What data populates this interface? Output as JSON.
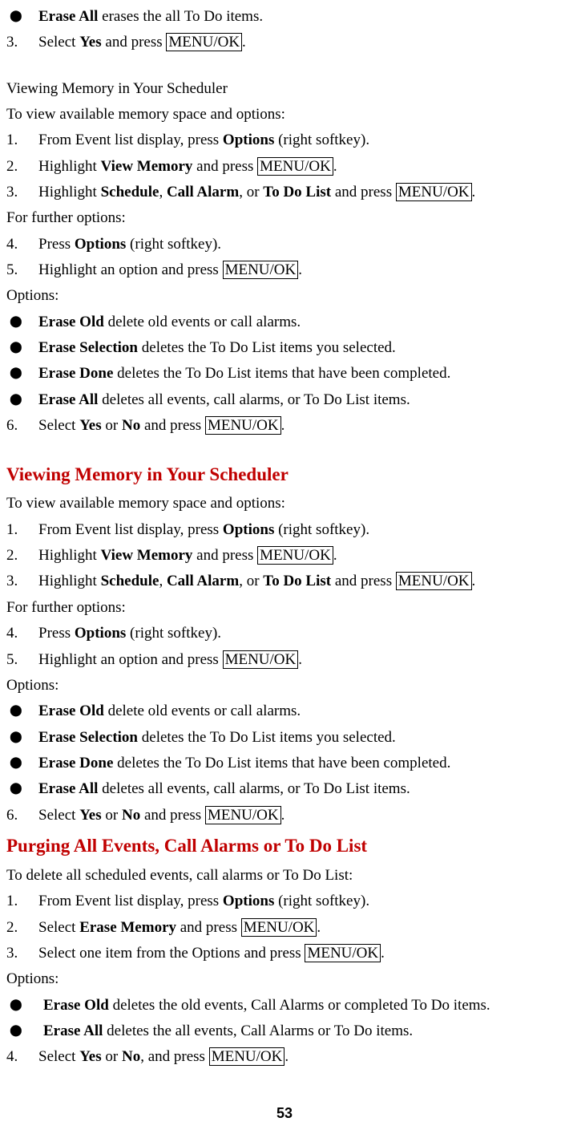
{
  "top_bullet": {
    "b": "Erase All",
    "rest": " erases the all To Do items."
  },
  "top_step3": {
    "n": "3.",
    "pre": "Select ",
    "b1": "Yes",
    "mid": " and press ",
    "key": "MENU/OK",
    "post": "."
  },
  "sec1_title": "Viewing Memory in Your Scheduler",
  "sec1_intro": "To view available memory space and options:",
  "sec1_steps": [
    {
      "n": "1.",
      "parts": [
        {
          "t": "From Event list display, press "
        },
        {
          "t": "Options",
          "b": 1
        },
        {
          "t": " (right softkey)."
        }
      ]
    },
    {
      "n": "2.",
      "parts": [
        {
          "t": "Highlight "
        },
        {
          "t": "View Memory",
          "b": 1
        },
        {
          "t": " and press "
        },
        {
          "t": "MENU/OK",
          "k": 1
        },
        {
          "t": "."
        }
      ]
    },
    {
      "n": "3.",
      "parts": [
        {
          "t": "Highlight "
        },
        {
          "t": "Schedule",
          "b": 1
        },
        {
          "t": ", "
        },
        {
          "t": "Call Alarm",
          "b": 1
        },
        {
          "t": ", or "
        },
        {
          "t": "To Do List",
          "b": 1
        },
        {
          "t": " and press "
        },
        {
          "t": "MENU/OK",
          "k": 1
        },
        {
          "t": "."
        }
      ]
    }
  ],
  "sec1_further": "For further options:",
  "sec1_steps_b": [
    {
      "n": "4.",
      "parts": [
        {
          "t": "Press "
        },
        {
          "t": "Options",
          "b": 1
        },
        {
          "t": " (right softkey)."
        }
      ]
    },
    {
      "n": "5.",
      "parts": [
        {
          "t": "Highlight an option and press "
        },
        {
          "t": "MENU/OK",
          "k": 1
        },
        {
          "t": "."
        }
      ]
    }
  ],
  "options_label": "Options:",
  "sec1_bullets": [
    {
      "b": "Erase Old",
      "rest": " delete old events or call alarms."
    },
    {
      "b": "Erase Selection",
      "rest": " deletes the To Do List items you selected."
    },
    {
      "b": "Erase Done",
      "rest": " deletes the To Do List items that have been completed."
    },
    {
      "b": "Erase All",
      "rest": " deletes all events, call alarms, or To Do List items."
    }
  ],
  "sec1_step6": {
    "n": "6.",
    "parts": [
      {
        "t": "Select "
      },
      {
        "t": "Yes",
        "b": 1
      },
      {
        "t": " or "
      },
      {
        "t": "No",
        "b": 1
      },
      {
        "t": " and press "
      },
      {
        "t": "MENU/OK",
        "k": 1
      },
      {
        "t": "."
      }
    ]
  },
  "sec2_title": "Viewing Memory in Your Scheduler",
  "sec2_intro": "To view available memory space and options:",
  "sec2_steps": [
    {
      "n": "1.",
      "parts": [
        {
          "t": "From Event list display, press "
        },
        {
          "t": "Options",
          "b": 1
        },
        {
          "t": " (right softkey)."
        }
      ]
    },
    {
      "n": "2.",
      "parts": [
        {
          "t": "Highlight "
        },
        {
          "t": "View Memory",
          "b": 1
        },
        {
          "t": " and press "
        },
        {
          "t": "MENU/OK",
          "k": 1
        },
        {
          "t": "."
        }
      ]
    },
    {
      "n": "3.",
      "parts": [
        {
          "t": "Highlight "
        },
        {
          "t": "Schedule",
          "b": 1
        },
        {
          "t": ", "
        },
        {
          "t": "Call Alarm",
          "b": 1
        },
        {
          "t": ", or "
        },
        {
          "t": "To Do List",
          "b": 1
        },
        {
          "t": " and press "
        },
        {
          "t": "MENU/OK",
          "k": 1
        },
        {
          "t": "."
        }
      ]
    }
  ],
  "sec2_further": "For further options:",
  "sec2_steps_b": [
    {
      "n": "4.",
      "parts": [
        {
          "t": "Press "
        },
        {
          "t": "Options",
          "b": 1
        },
        {
          "t": " (right softkey)."
        }
      ]
    },
    {
      "n": "5.",
      "parts": [
        {
          "t": "Highlight an option and press "
        },
        {
          "t": "MENU/OK",
          "k": 1
        },
        {
          "t": "."
        }
      ]
    }
  ],
  "sec2_bullets": [
    {
      "b": "Erase Old",
      "rest": " delete old events or call alarms."
    },
    {
      "b": "Erase Selection",
      "rest": " deletes the To Do List items you selected."
    },
    {
      "b": "Erase Done",
      "rest": " deletes the To Do List items that have been completed."
    },
    {
      "b": "Erase All",
      "rest": " deletes all events, call alarms, or To Do List items."
    }
  ],
  "sec2_step6": {
    "n": "6.",
    "parts": [
      {
        "t": "Select "
      },
      {
        "t": "Yes",
        "b": 1
      },
      {
        "t": " or "
      },
      {
        "t": "No",
        "b": 1
      },
      {
        "t": " and press "
      },
      {
        "t": "MENU/OK",
        "k": 1
      },
      {
        "t": "."
      }
    ]
  },
  "sec3_title": "Purging All Events, Call Alarms or To Do List",
  "sec3_intro": "To delete all scheduled events, call alarms or To Do List:",
  "sec3_steps": [
    {
      "n": "1.",
      "parts": [
        {
          "t": "From Event list display, press "
        },
        {
          "t": "Options",
          "b": 1
        },
        {
          "t": " (right softkey)."
        }
      ]
    },
    {
      "n": "2.",
      "parts": [
        {
          "t": "Select "
        },
        {
          "t": "Erase Memory",
          "b": 1
        },
        {
          "t": " and press "
        },
        {
          "t": "MENU/OK",
          "k": 1
        },
        {
          "t": "."
        }
      ]
    },
    {
      "n": "3.",
      "parts": [
        {
          "t": "Select one item from the Options and press "
        },
        {
          "t": "MENU/OK",
          "k": 1
        },
        {
          "t": "."
        }
      ]
    }
  ],
  "sec3_bullets": [
    {
      "b": "Erase Old",
      "rest": " deletes the old events, Call Alarms or completed To Do items."
    },
    {
      "b": "Erase All",
      "rest": " deletes the all events, Call Alarms or To Do items."
    }
  ],
  "sec3_step4": {
    "n": "4.",
    "parts": [
      {
        "t": "Select "
      },
      {
        "t": "Yes",
        "b": 1
      },
      {
        "t": " or "
      },
      {
        "t": "No",
        "b": 1
      },
      {
        "t": ", and press "
      },
      {
        "t": "MENU/OK",
        "k": 1
      },
      {
        "t": "."
      }
    ]
  },
  "page_num": "53"
}
